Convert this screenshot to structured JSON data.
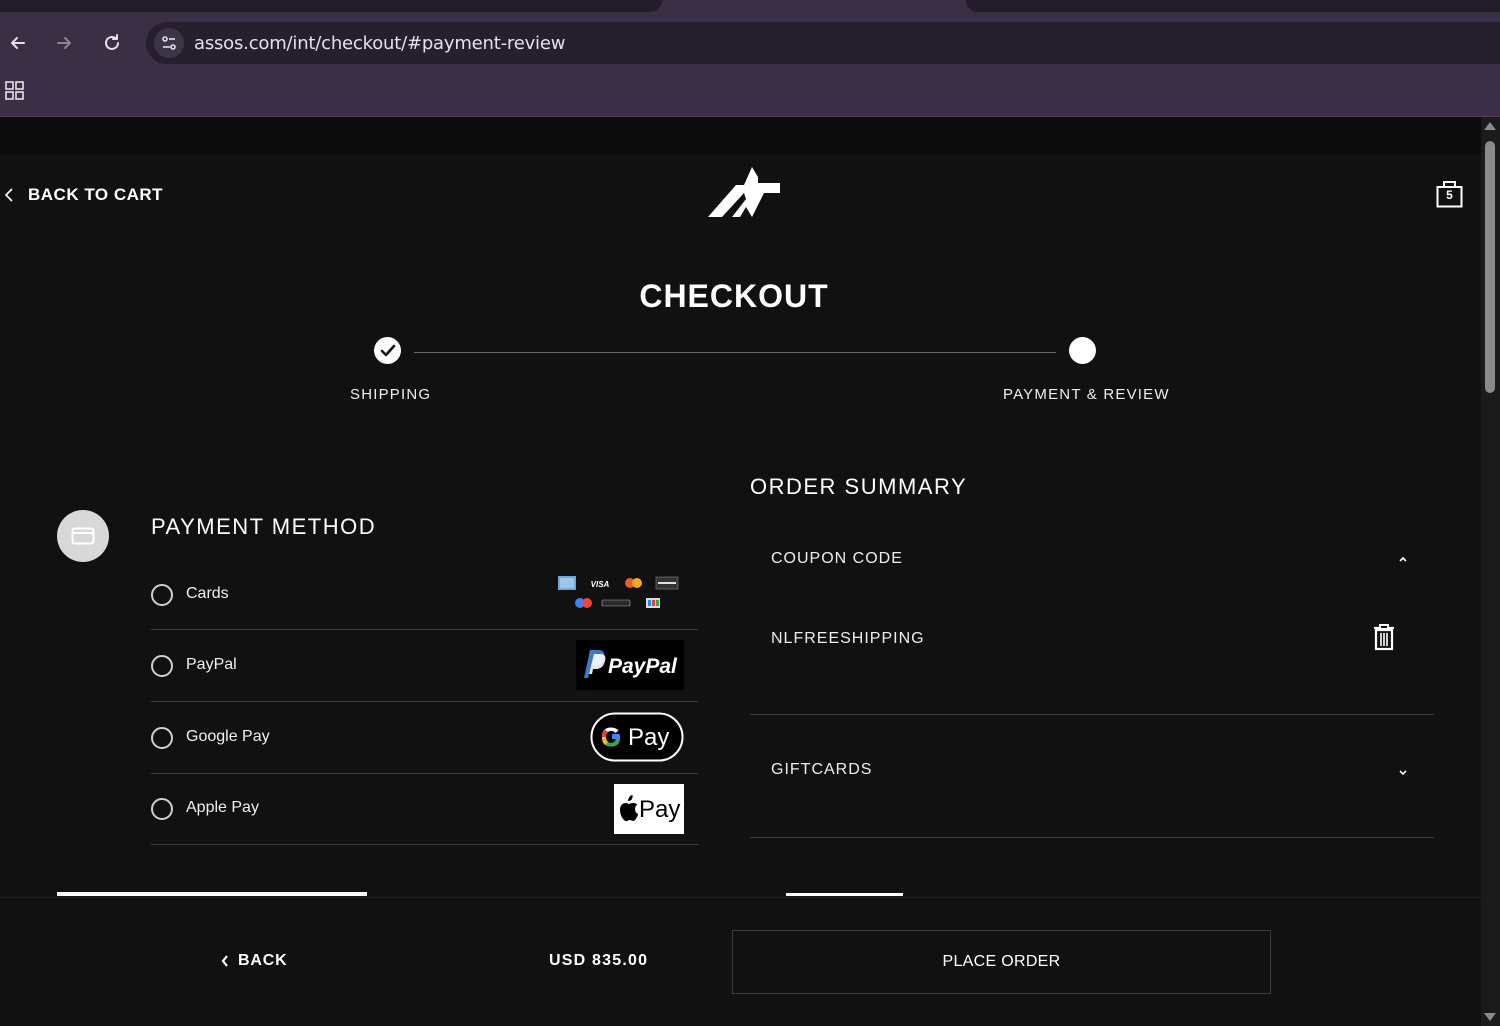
{
  "browser": {
    "url": "assos.com/int/checkout/#payment-review"
  },
  "header": {
    "back_to_cart": "BACK TO CART",
    "cart_count": "5"
  },
  "checkout": {
    "title": "CHECKOUT",
    "steps": [
      {
        "label": "SHIPPING",
        "state": "done"
      },
      {
        "label": "PAYMENT & REVIEW",
        "state": "current"
      }
    ]
  },
  "payment": {
    "title": "PAYMENT METHOD",
    "methods": [
      {
        "label": "Cards",
        "icon": "card-brands-icon"
      },
      {
        "label": "PayPal",
        "icon": "paypal-logo-icon",
        "logo_text": "PayPal"
      },
      {
        "label": "Google Pay",
        "icon": "gpay-logo-icon",
        "logo_text": "Pay"
      },
      {
        "label": "Apple Pay",
        "icon": "applepay-logo-icon",
        "logo_text": "Pay"
      }
    ]
  },
  "summary": {
    "title": "ORDER SUMMARY",
    "coupon_label": "COUPON CODE",
    "coupon_value": "NLFREESHIPPING",
    "giftcards_label": "GIFTCARDS"
  },
  "footer": {
    "back_label": "BACK",
    "total": "USD 835.00",
    "place_order": "PLACE ORDER"
  },
  "colors": {
    "background": "#111111",
    "chrome": "#3a2f45",
    "text": "#ffffff"
  }
}
